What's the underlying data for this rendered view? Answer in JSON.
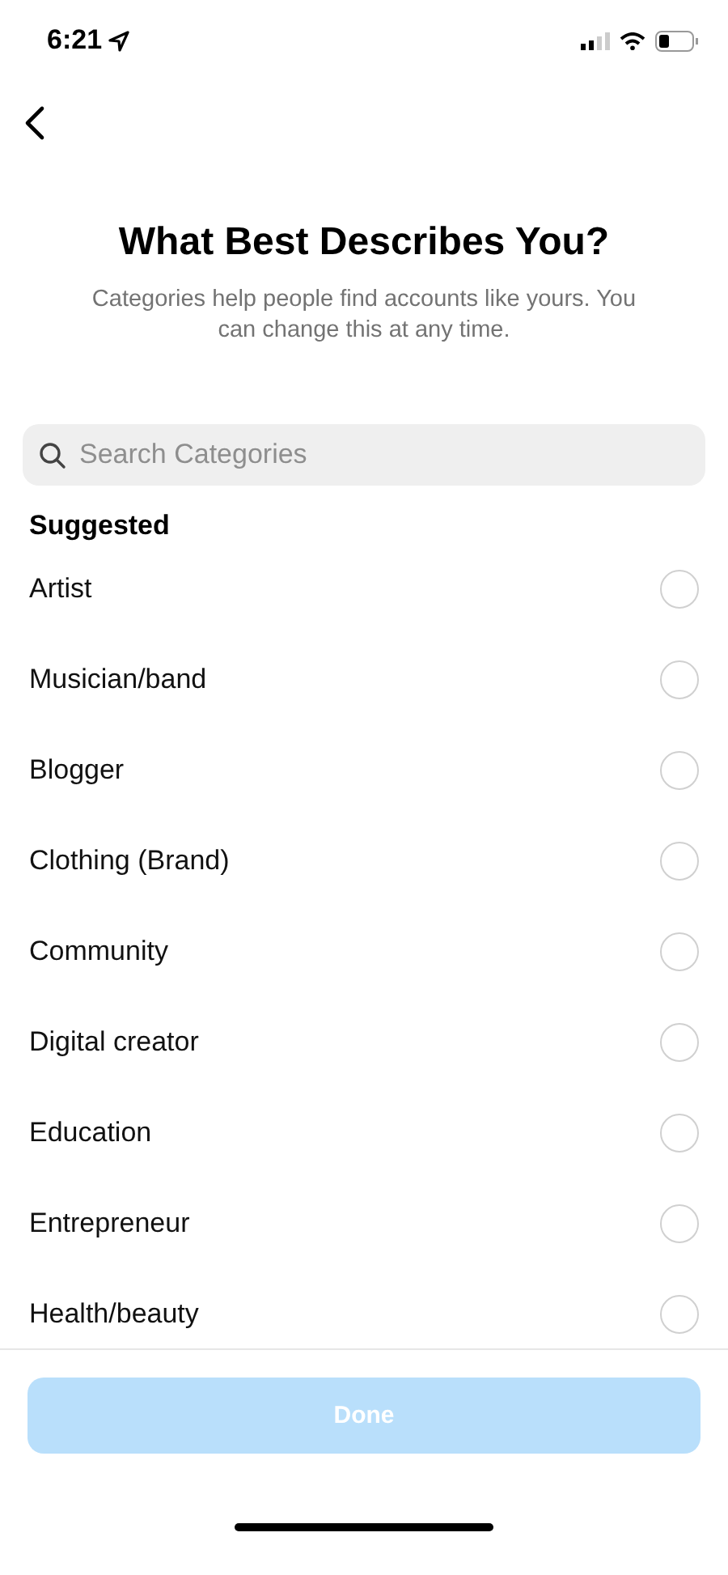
{
  "status_bar": {
    "time": "6:21"
  },
  "title": "What Best Describes You?",
  "subtitle": "Categories help people find accounts like yours. You can change this at any time.",
  "search": {
    "placeholder": "Search Categories"
  },
  "section_title": "Suggested",
  "categories": [
    {
      "label": "Artist",
      "selected": false
    },
    {
      "label": "Musician/band",
      "selected": false
    },
    {
      "label": "Blogger",
      "selected": false
    },
    {
      "label": "Clothing (Brand)",
      "selected": false
    },
    {
      "label": "Community",
      "selected": false
    },
    {
      "label": "Digital creator",
      "selected": false
    },
    {
      "label": "Education",
      "selected": false
    },
    {
      "label": "Entrepreneur",
      "selected": false
    },
    {
      "label": "Health/beauty",
      "selected": false
    }
  ],
  "done_button": {
    "label": "Done",
    "disabled": true
  }
}
